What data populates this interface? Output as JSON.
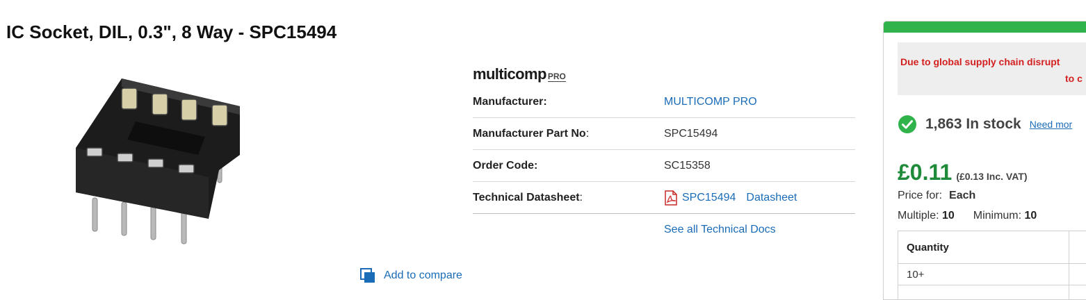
{
  "product": {
    "title": "IC Socket, DIL, 0.3\", 8 Way - SPC15494"
  },
  "compare": {
    "label": "Add to compare"
  },
  "brand": {
    "name": "multicomp",
    "suffix": "PRO"
  },
  "specs": {
    "manufacturer_label": "Manufacturer:",
    "manufacturer_value": "MULTICOMP PRO",
    "part_label": "Manufacturer Part No",
    "part_colon": ":",
    "part_value": "SPC15494",
    "order_label": "Order Code:",
    "order_value": "SC15358",
    "datasheet_label": "Technical Datasheet",
    "datasheet_colon": ":",
    "datasheet_part": "SPC15494",
    "datasheet_word": "Datasheet",
    "see_all": "See all Technical Docs"
  },
  "buy_panel": {
    "accent_color": "#2fb34a",
    "notice_line1": "Due to global supply chain disrupt",
    "notice_line2": "to c",
    "stock_text": "1,863 In stock",
    "need_more": "Need mor",
    "price": "£0.11",
    "price_vat": "(£0.13 Inc. VAT)",
    "price_for_label": "Price for:",
    "price_for_value": "Each",
    "multiple_label": "Multiple:",
    "multiple_value": "10",
    "minimum_label": "Minimum:",
    "minimum_value": "10",
    "table_header": "Quantity",
    "table_row1": "10+"
  },
  "icons": {
    "compare": "compare-icon",
    "pdf": "pdf-icon",
    "stock": "check-circle-icon"
  }
}
